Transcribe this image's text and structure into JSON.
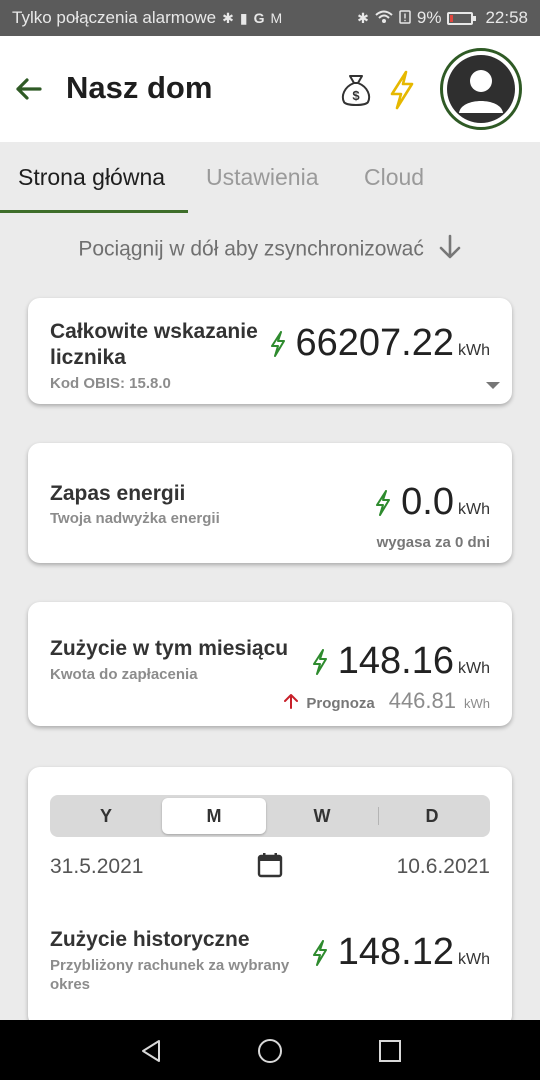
{
  "status_bar": {
    "carrier": "Tylko połączenia alarmowe",
    "battery": "9%",
    "time": "22:58",
    "icons": [
      "bluetooth-icon",
      "battery-saver-icon",
      "google-icon",
      "gmail-icon",
      "bluetooth-icon",
      "wifi-icon",
      "alert-icon",
      "battery-low-icon"
    ]
  },
  "app_bar": {
    "title": "Nasz dom",
    "icons": [
      "back-arrow-icon",
      "money-bag-icon",
      "bolt-icon",
      "avatar-icon"
    ]
  },
  "tabs": [
    {
      "label": "Strona główna",
      "active": true
    },
    {
      "label": "Ustawienia",
      "active": false
    },
    {
      "label": "Cloud",
      "active": false
    }
  ],
  "sync_hint": "Pociągnij w dół aby zsynchronizować",
  "cards": {
    "meter": {
      "title_line1": "Całkowite wskazanie",
      "title_line2": "licznika",
      "subtitle": "Kod OBIS: 15.8.0",
      "value": "66207.22",
      "unit": "kWh"
    },
    "reserve": {
      "title": "Zapas energii",
      "subtitle": "Twoja nadwyżka energii",
      "value": "0.0",
      "unit": "kWh",
      "expiry": "wygasa za 0 dni"
    },
    "month": {
      "title": "Zużycie w tym miesiącu",
      "subtitle": "Kwota do zapłacenia",
      "value": "148.16",
      "unit": "kWh",
      "forecast_label": "Prognoza",
      "forecast_value": "446.81",
      "forecast_unit": "kWh"
    },
    "history": {
      "segments": [
        "Y",
        "M",
        "W",
        "D"
      ],
      "active_segment": "M",
      "date_from": "31.5.2021",
      "date_to": "10.6.2021",
      "title": "Zużycie historyczne",
      "subtitle_line1": "Przybliżony rachunek za wybrany",
      "subtitle_line2": "okres",
      "value": "148.12",
      "unit": "kWh"
    }
  },
  "colors": {
    "accent_green": "#3e6e2a",
    "bolt_green": "#2e8b2e",
    "bolt_yellow": "#e6b800",
    "forecast_red": "#c8202a"
  }
}
